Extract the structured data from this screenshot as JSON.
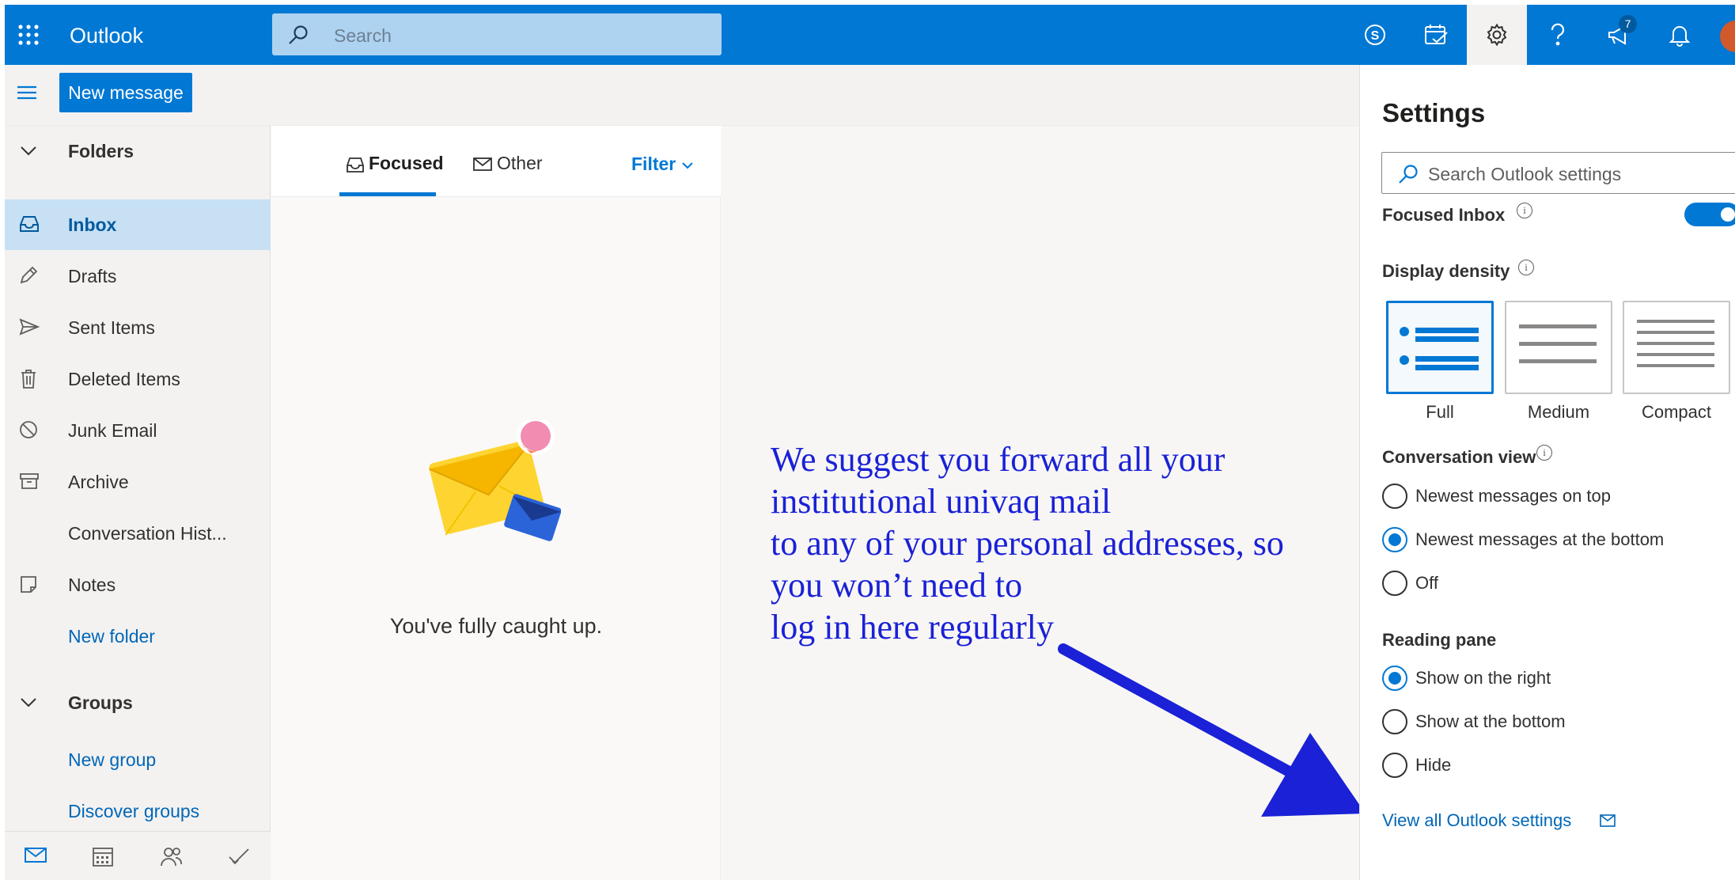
{
  "header": {
    "waffle_icon": "app-launcher-icon",
    "app_name": "Outlook",
    "search_placeholder": "Search",
    "notification_count": "7",
    "accent": "#0078d4"
  },
  "command": {
    "new_message": "New message"
  },
  "nav": {
    "folders_header": "Folders",
    "items": [
      {
        "label": "Inbox",
        "icon": "inbox-icon"
      },
      {
        "label": "Drafts",
        "icon": "pencil-icon"
      },
      {
        "label": "Sent Items",
        "icon": "send-icon"
      },
      {
        "label": "Deleted Items",
        "icon": "trash-icon"
      },
      {
        "label": "Junk Email",
        "icon": "block-icon"
      },
      {
        "label": "Archive",
        "icon": "archive-icon"
      },
      {
        "label": "Conversation Hist..."
      },
      {
        "label": "Notes",
        "icon": "note-icon"
      }
    ],
    "new_folder": "New folder",
    "groups_header": "Groups",
    "new_group": "New group",
    "discover_groups": "Discover groups"
  },
  "message_list": {
    "tab_focused": "Focused",
    "tab_other": "Other",
    "filter": "Filter",
    "empty_text": "You've fully caught up."
  },
  "annotation": {
    "text": "We suggest you forward all your\ninstitutional univaq mail\nto any of your personal addresses, so\nyou won’t need to\nlog in here regularly",
    "color": "#1a21d6"
  },
  "settings": {
    "title": "Settings",
    "search_placeholder": "Search Outlook settings",
    "focused_inbox": "Focused Inbox",
    "focused_inbox_on": true,
    "display_density": "Display density",
    "density_options": [
      "Full",
      "Medium",
      "Compact"
    ],
    "density_selected": "Full",
    "conversation_view": "Conversation view",
    "conversation_options": [
      "Newest messages on top",
      "Newest messages at the bottom",
      "Off"
    ],
    "conversation_selected": "Newest messages at the bottom",
    "reading_pane": "Reading pane",
    "reading_options": [
      "Show on the right",
      "Show at the bottom",
      "Hide"
    ],
    "reading_selected": "Show on the right",
    "view_all": "View all Outlook settings"
  }
}
